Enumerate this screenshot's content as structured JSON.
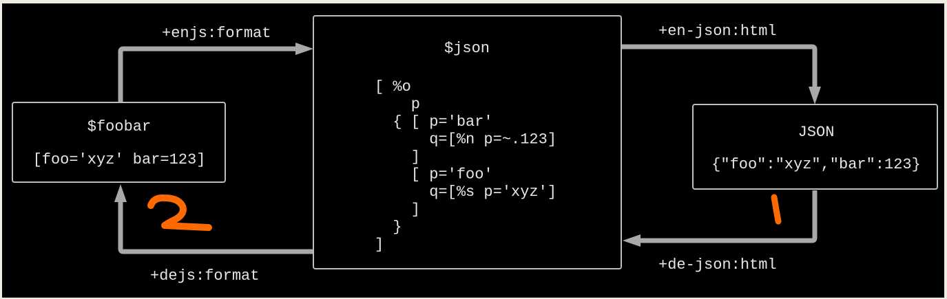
{
  "nodes": {
    "foobar": {
      "title": "$foobar",
      "value": "[foo='xyz' bar=123]"
    },
    "json_var": {
      "title": "$json",
      "lines": [
        "[ %o",
        "    p",
        "  { [ p='bar'",
        "      q=[%n p=~.123]",
        "    ]",
        "    [ p='foo'",
        "      q=[%s p='xyz']",
        "    ]",
        "  }",
        "]"
      ]
    },
    "json_text": {
      "title": "JSON",
      "value": "{\"foo\":\"xyz\",\"bar\":123}"
    }
  },
  "edges": {
    "enjs": "+enjs:format",
    "en_json": "+en-json:html",
    "de_json": "+de-json:html",
    "dejs": "+dejs:format"
  },
  "annotations": {
    "step_1": "1",
    "step_2": "2"
  },
  "colors": {
    "background": "#000000",
    "page": "#f1ece3",
    "box_border": "#bdbdbd",
    "connector": "#a9a9a9",
    "text": "#e6e6e6",
    "annotation": "#ff6a00"
  }
}
